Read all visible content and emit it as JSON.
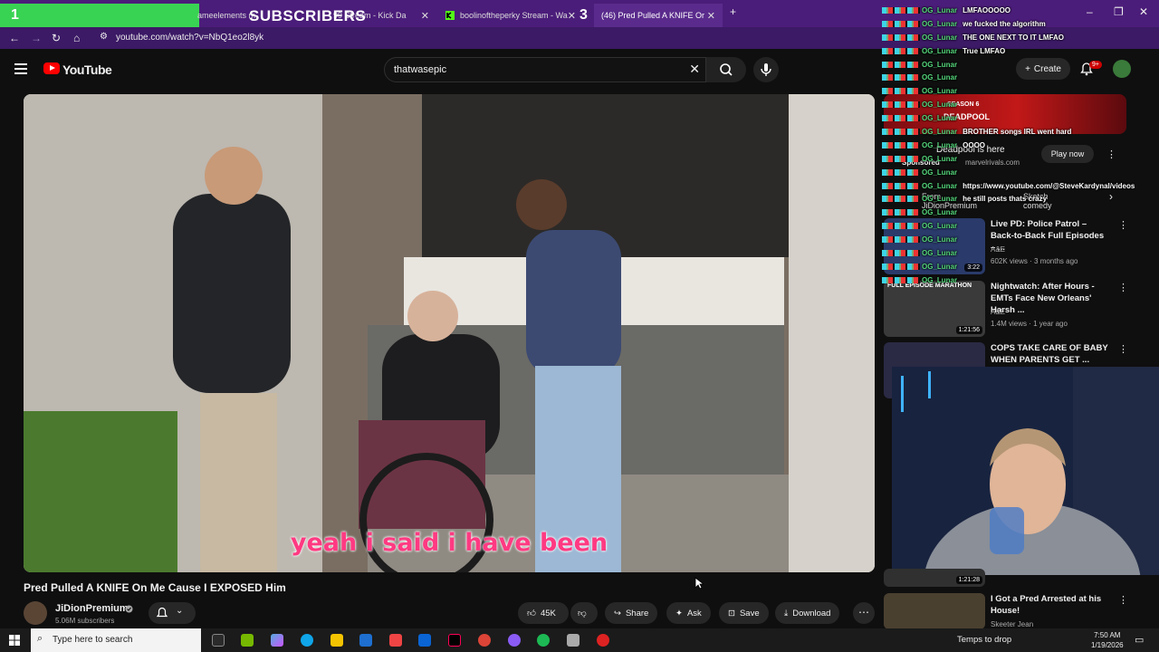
{
  "goal_overlay": {
    "count_start": "1",
    "label": "SUBSCRIBERS",
    "count_end": "3"
  },
  "browser": {
    "tabs": [
      {
        "label": "ameelements m"
      },
      {
        "label": "99 Stream - Kick Da"
      },
      {
        "label": "boolinoftheperky Stream - Wa"
      },
      {
        "label": "(46) Pred Pulled A KNIFE Or"
      }
    ],
    "url": "youtube.com/watch?v=NbQ1eo2l8yk"
  },
  "youtube": {
    "logo_text": "YouTube",
    "search_value": "thatwasepic",
    "create_label": "Create",
    "notif_badge": "9+"
  },
  "video": {
    "caption": "yeah i said i have been",
    "title": "Pred Pulled A KNIFE On Me Cause I EXPOSED Him",
    "channel": "JiDionPremium",
    "subscribers": "5.06M subscribers",
    "actions": {
      "likes": "45K",
      "share": "Share",
      "ask": "Ask",
      "save": "Save",
      "download": "Download"
    }
  },
  "ad": {
    "title": "Deadpool is here",
    "sponsored": "Sponsored",
    "domain": "marvelrivals.com",
    "cta": "Play now",
    "banner_line1": "SEASON 6",
    "banner_line2": "DEADPOOL"
  },
  "chips": [
    "From JiDionPremium",
    "Sketch comedy"
  ],
  "recommendations": [
    {
      "title": "Live PD: Police Patrol – Back-to-Back Full Episodes – ...",
      "channel": "A&E",
      "meta": "602K views · 3 months ago",
      "duration": "3:22",
      "color": "#2a3a6a"
    },
    {
      "title": "Nightwatch: After Hours - EMTs Face New Orleans' Harsh ...",
      "channel": "A&E",
      "meta": "1.4M views · 1 year ago",
      "duration": "1:21:56",
      "color": "#3a3a3a",
      "thumb_text": "FULL EPISODE MARATHON"
    },
    {
      "title": "COPS TAKE CARE OF BABY WHEN PARENTS GET ...",
      "channel": "",
      "meta": "",
      "duration": "",
      "color": "#2a2a44"
    },
    {
      "title": "",
      "channel": "",
      "meta": "",
      "duration": "1:21:28",
      "color": "#303030"
    },
    {
      "title": "I Got a Pred Arrested at his House!",
      "channel": "Skeeter Jean",
      "meta": "",
      "duration": "",
      "color": "#4a4030"
    }
  ],
  "chat": [
    {
      "user": "OG_Lunar",
      "msg": "LMFAOOOOO"
    },
    {
      "user": "OG_Lunar",
      "msg": "we fucked the algorithm"
    },
    {
      "user": "OG_Lunar",
      "msg": "THE ONE NEXT TO IT LMFAO"
    },
    {
      "user": "OG_Lunar",
      "msg": "True LMFAO"
    },
    {
      "user": "OG_Lunar",
      "msg": ""
    },
    {
      "user": "OG_Lunar",
      "msg": ""
    },
    {
      "user": "OG_Lunar",
      "msg": ""
    },
    {
      "user": "OG_Lunar",
      "msg": ""
    },
    {
      "user": "OG_Lunar",
      "msg": ""
    },
    {
      "user": "OG_Lunar",
      "msg": "BROTHER songs IRL went hard"
    },
    {
      "user": "OG_Lunar",
      "msg": "OOOO"
    },
    {
      "user": "OG_Lunar",
      "msg": ""
    },
    {
      "user": "OG_Lunar",
      "msg": ""
    },
    {
      "user": "OG_Lunar",
      "msg": "https://www.youtube.com/@SteveKardynal/videos"
    },
    {
      "user": "OG_Lunar",
      "msg": "he still posts thats crazy"
    },
    {
      "user": "OG_Lunar",
      "msg": ""
    },
    {
      "user": "OG_Lunar",
      "msg": ""
    },
    {
      "user": "OG_Lunar",
      "msg": ""
    },
    {
      "user": "OG_Lunar",
      "msg": ""
    },
    {
      "user": "OG_Lunar",
      "msg": ""
    },
    {
      "user": "OG_Lunar",
      "msg": ""
    }
  ],
  "taskbar": {
    "search_placeholder": "Type here to search",
    "weather": "Temps to drop",
    "time": "7:50 AM",
    "date": "1/19/2026"
  },
  "colors": {
    "accent_red": "#ff0000",
    "chrome_purple": "#4b1d7a",
    "goal_green": "#39d353",
    "caption_pink": "#ff3a82"
  }
}
